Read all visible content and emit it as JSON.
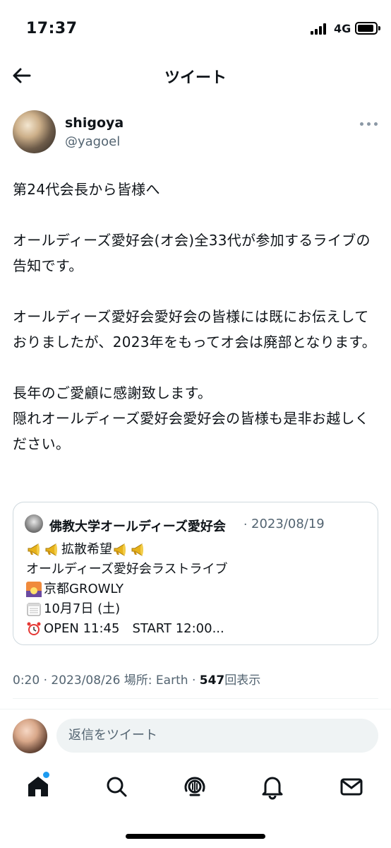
{
  "status_bar": {
    "time": "17:37",
    "network": "4G"
  },
  "header": {
    "title": "ツイート"
  },
  "tweet": {
    "display_name": "shigoya",
    "handle": "@yagoel",
    "text": "第24代会長から皆様へ\n\nオールディーズ愛好会(オ会)全33代が参加するライブの告知です。\n\nオールディーズ愛好会愛好会の皆様には既にお伝えしておりましたが、2023年をもってオ会は廃部となります。\n\n長年のご愛顧に感謝致します。\n隠れオールディーズ愛好会愛好会の皆様も是非お越しください。"
  },
  "quote": {
    "name": "佛教大学オールディーズ愛好会",
    "separator": "·",
    "date": "2023/08/19",
    "lines": [
      {
        "emoji_before": [
          "megaphone-icon",
          "megaphone-icon"
        ],
        "text": "拡散希望",
        "emoji_after": [
          "megaphone-icon",
          "megaphone-icon"
        ]
      },
      {
        "emoji_before": [],
        "text": "オールディーズ愛好会ラストライブ",
        "emoji_after": []
      },
      {
        "emoji_before": [
          "sunrise-icon"
        ],
        "text": "京都GROWLY",
        "emoji_after": []
      },
      {
        "emoji_before": [
          "calendar-icon"
        ],
        "text": "10月7日 (土)",
        "emoji_after": []
      },
      {
        "emoji_before": [
          "alarm-clock-icon"
        ],
        "text": "OPEN 11:45　START 12:00...",
        "emoji_after": []
      }
    ]
  },
  "meta": {
    "time": "0:20",
    "date": "2023/08/26",
    "location_label": "場所: Earth",
    "views_count": "547",
    "views_label": "回表示",
    "sep": "·"
  },
  "reply": {
    "placeholder": "返信をツイート"
  },
  "tabbar": {
    "items": [
      "home-icon",
      "search-icon",
      "spaces-icon",
      "bell-icon",
      "mail-icon"
    ]
  },
  "colors": {
    "accent": "#1d9bf0",
    "text": "#0f1419",
    "secondary": "#536471",
    "border": "#cfd9de"
  }
}
